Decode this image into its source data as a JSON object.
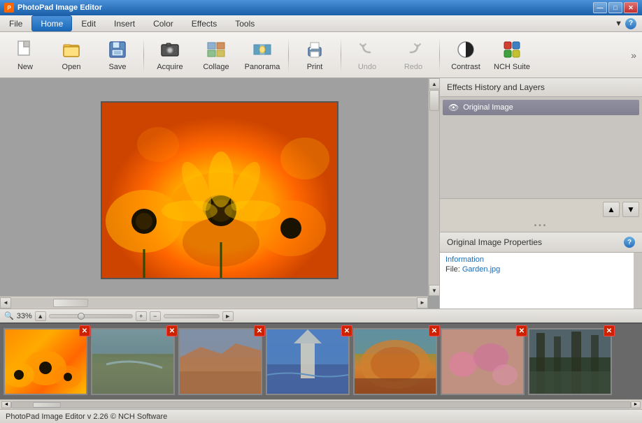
{
  "window": {
    "title": "PhotoPad Image Editor",
    "titlebar_buttons": [
      "—",
      "□",
      "✕"
    ]
  },
  "menu": {
    "items": [
      "File",
      "Home",
      "Edit",
      "Insert",
      "Color",
      "Effects",
      "Tools"
    ],
    "active": "Home",
    "help_label": "▼"
  },
  "toolbar": {
    "buttons": [
      {
        "id": "new",
        "label": "New",
        "icon": "📄"
      },
      {
        "id": "open",
        "label": "Open",
        "icon": "📁"
      },
      {
        "id": "save",
        "label": "Save",
        "icon": "💾"
      },
      {
        "id": "acquire",
        "label": "Acquire",
        "icon": "📷"
      },
      {
        "id": "collage",
        "label": "Collage",
        "icon": "🖼"
      },
      {
        "id": "panorama",
        "label": "Panorama",
        "icon": "🌄"
      },
      {
        "id": "print",
        "label": "Print",
        "icon": "🖨"
      },
      {
        "id": "undo",
        "label": "Undo",
        "icon": "↩",
        "disabled": true
      },
      {
        "id": "redo",
        "label": "Redo",
        "icon": "↪",
        "disabled": true
      },
      {
        "id": "contrast",
        "label": "Contrast",
        "icon": "◑"
      },
      {
        "id": "nch",
        "label": "NCH Suite",
        "icon": "🧩"
      }
    ]
  },
  "right_panel": {
    "header": "Effects History and Layers",
    "effects": [
      {
        "label": "Original Image",
        "visible": true
      }
    ],
    "dots": "•••",
    "props_header": "Original Image Properties",
    "props": {
      "section": "Information",
      "file_label": "File:",
      "file_value": "Garden.jpg"
    }
  },
  "zoom": {
    "level": "33%",
    "zoom_in_label": "+",
    "zoom_out_label": "−"
  },
  "thumbnails": [
    {
      "id": "thumb-1",
      "bg": "thumb-flowers"
    },
    {
      "id": "thumb-2",
      "bg": "thumb-river"
    },
    {
      "id": "thumb-3",
      "bg": "thumb-desert"
    },
    {
      "id": "thumb-4",
      "bg": "thumb-ocean"
    },
    {
      "id": "thumb-5",
      "bg": "thumb-autumn"
    },
    {
      "id": "thumb-6",
      "bg": "thumb-pink"
    },
    {
      "id": "thumb-7",
      "bg": "thumb-forest"
    }
  ],
  "status": {
    "text": "PhotoPad Image Editor v 2.26 © NCH Software"
  }
}
